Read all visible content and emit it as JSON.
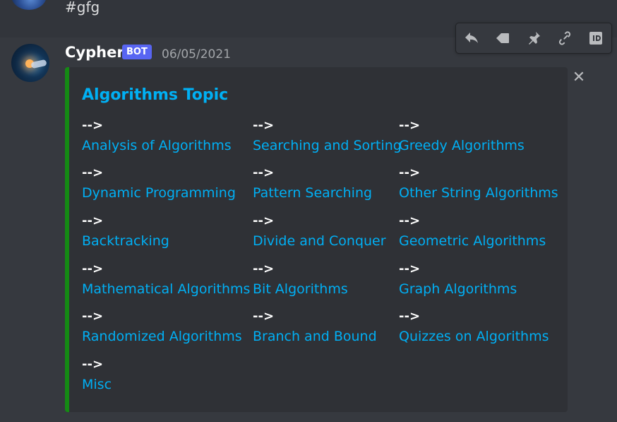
{
  "previous_message": {
    "text": "#gfg"
  },
  "message": {
    "author": "Cypher",
    "bot_tag": "BOT",
    "timestamp": "06/05/2021"
  },
  "toolbar": {
    "icons": [
      "reply-icon",
      "tag-icon",
      "pin-icon",
      "link-icon",
      "id-icon"
    ]
  },
  "embed": {
    "title": "Algorithms Topic",
    "accent_color": "#158a14",
    "close_symbol": "✕",
    "fields": [
      {
        "name": "-->",
        "value": "Analysis of Algorithms"
      },
      {
        "name": "-->",
        "value": "Searching and Sorting"
      },
      {
        "name": "-->",
        "value": "Greedy Algorithms"
      },
      {
        "name": "-->",
        "value": "Dynamic Programming"
      },
      {
        "name": "-->",
        "value": "Pattern Searching"
      },
      {
        "name": "-->",
        "value": "Other String Algorithms"
      },
      {
        "name": "-->",
        "value": "Backtracking"
      },
      {
        "name": "-->",
        "value": "Divide and Conquer"
      },
      {
        "name": "-->",
        "value": "Geometric Algorithms"
      },
      {
        "name": "-->",
        "value": "Mathematical Algorithms"
      },
      {
        "name": "-->",
        "value": "Bit Algorithms"
      },
      {
        "name": "-->",
        "value": "Graph Algorithms"
      },
      {
        "name": "-->",
        "value": "Randomized Algorithms"
      },
      {
        "name": "-->",
        "value": "Branch and Bound"
      },
      {
        "name": "-->",
        "value": "Quizzes on Algorithms"
      },
      {
        "name": "-->",
        "value": "Misc"
      }
    ]
  }
}
